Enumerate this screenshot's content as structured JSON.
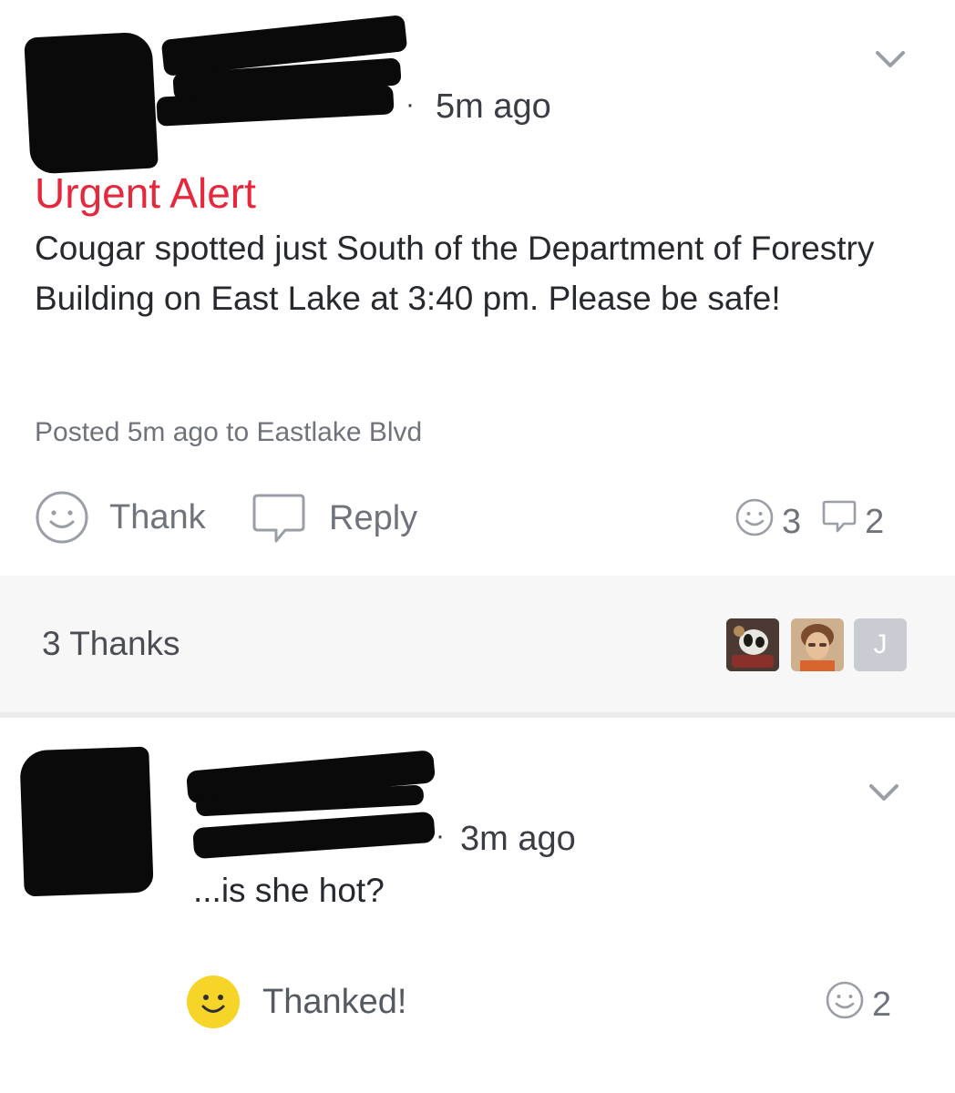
{
  "post": {
    "time": "5m ago",
    "title": "Urgent Alert",
    "body": "Cougar spotted just South of the Department of Forestry Building on East Lake at 3:40 pm. Please be safe!",
    "posted_meta": "Posted 5m ago to Eastlake Blvd",
    "actions": {
      "thank_label": "Thank",
      "reply_label": "Reply"
    },
    "counts": {
      "thanks": "3",
      "replies": "2"
    }
  },
  "thanks_bar": {
    "label": "3 Thanks",
    "avatars": [
      {
        "type": "photo",
        "icon": "avatar-photo-1"
      },
      {
        "type": "photo",
        "icon": "avatar-photo-2"
      },
      {
        "type": "initial",
        "initial": "J"
      }
    ]
  },
  "reply": {
    "time": "3m ago",
    "body": "...is she hot?",
    "thanked_label": "Thanked!",
    "thanks_count": "2"
  },
  "colors": {
    "alert_red": "#e5283c",
    "thanked_yellow": "#f6d428",
    "icon_gray": "#8a8e96"
  }
}
